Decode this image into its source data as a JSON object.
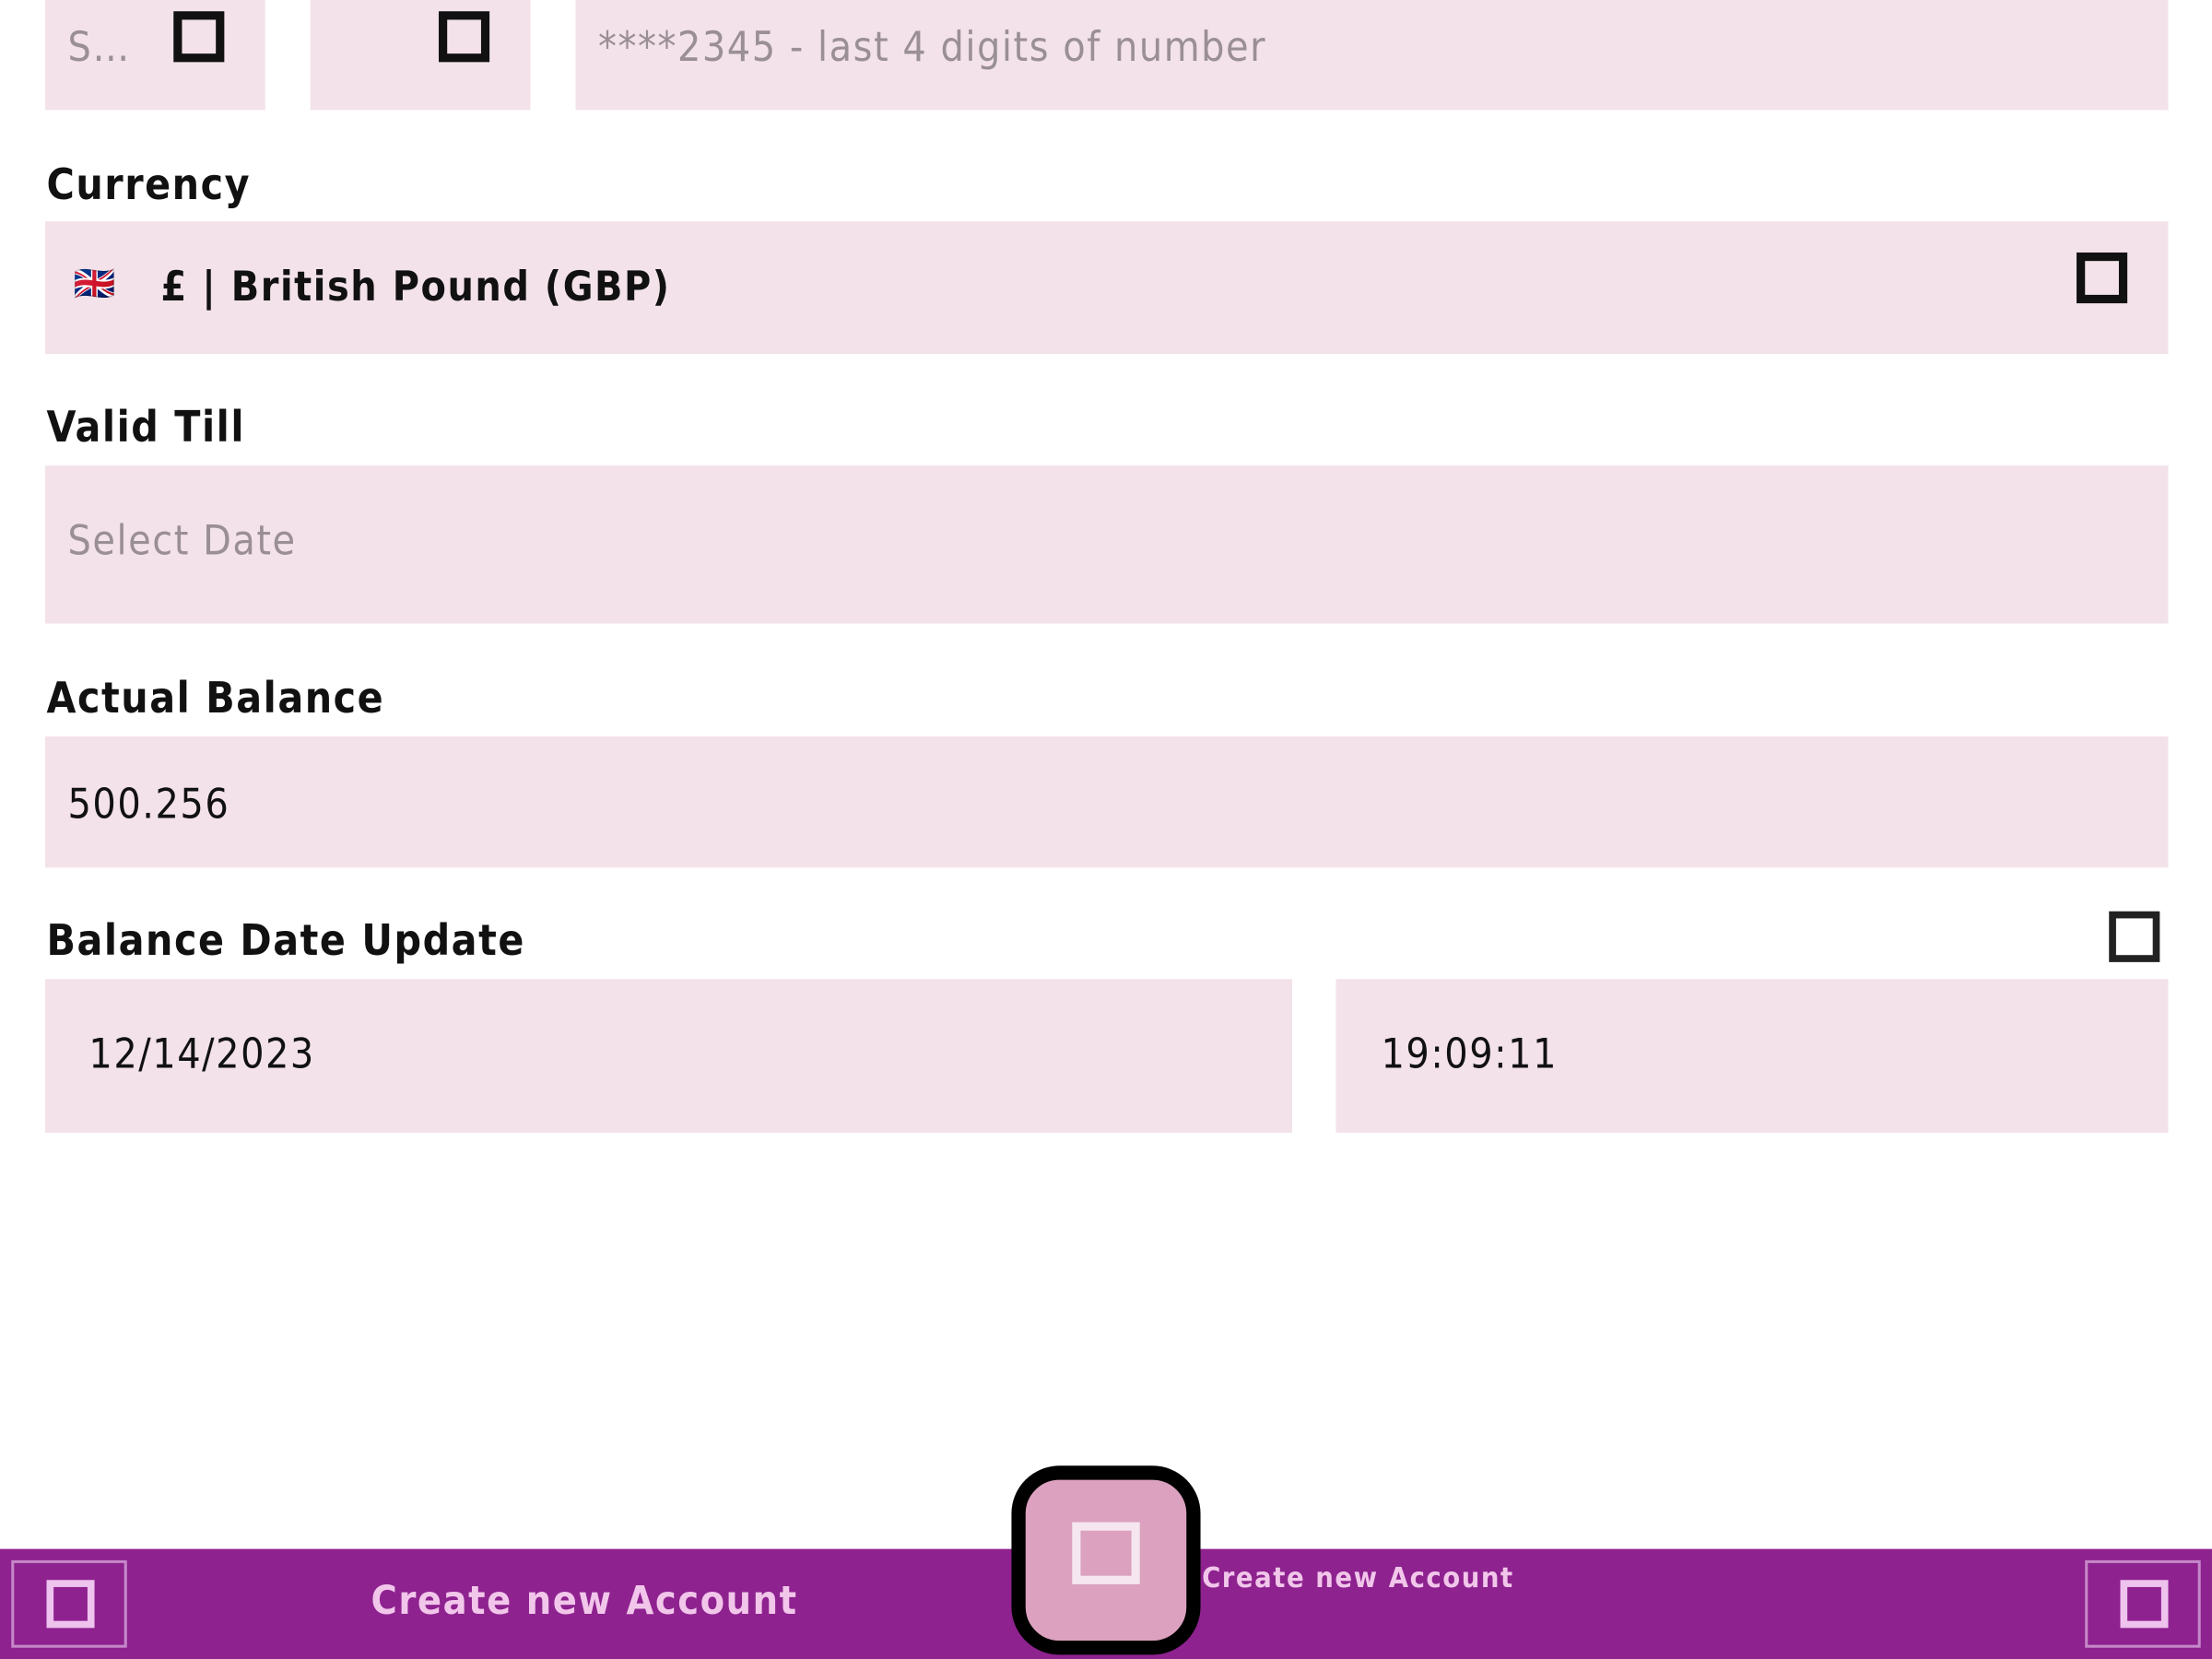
{
  "top_row": {
    "field1_value": "S…",
    "field3_placeholder": "****2345 - last 4 digits of number"
  },
  "currency": {
    "label": "Currency",
    "flag": "🇬🇧",
    "value": "£ | British Pound (GBP)"
  },
  "valid_till": {
    "label": "Valid Till",
    "placeholder": "Select Date"
  },
  "actual_balance": {
    "label": "Actual Balance",
    "value": "500.256"
  },
  "balance_date_update": {
    "label": "Balance Date Update",
    "date": "12/14/2023",
    "time": "19:09:11"
  },
  "bottom_bar": {
    "left_label": "Create new Account",
    "fab_label": "Create new Account",
    "color": "#8e228f"
  },
  "icons": {
    "top_field1_dropdown": "dropdown-icon",
    "top_field2_dropdown": "dropdown-icon",
    "currency_dropdown": "dropdown-icon",
    "balance_date_toggle": "checkbox-icon",
    "bottom_left": "menu-icon",
    "fab": "add-icon",
    "bottom_right": "settings-icon"
  }
}
